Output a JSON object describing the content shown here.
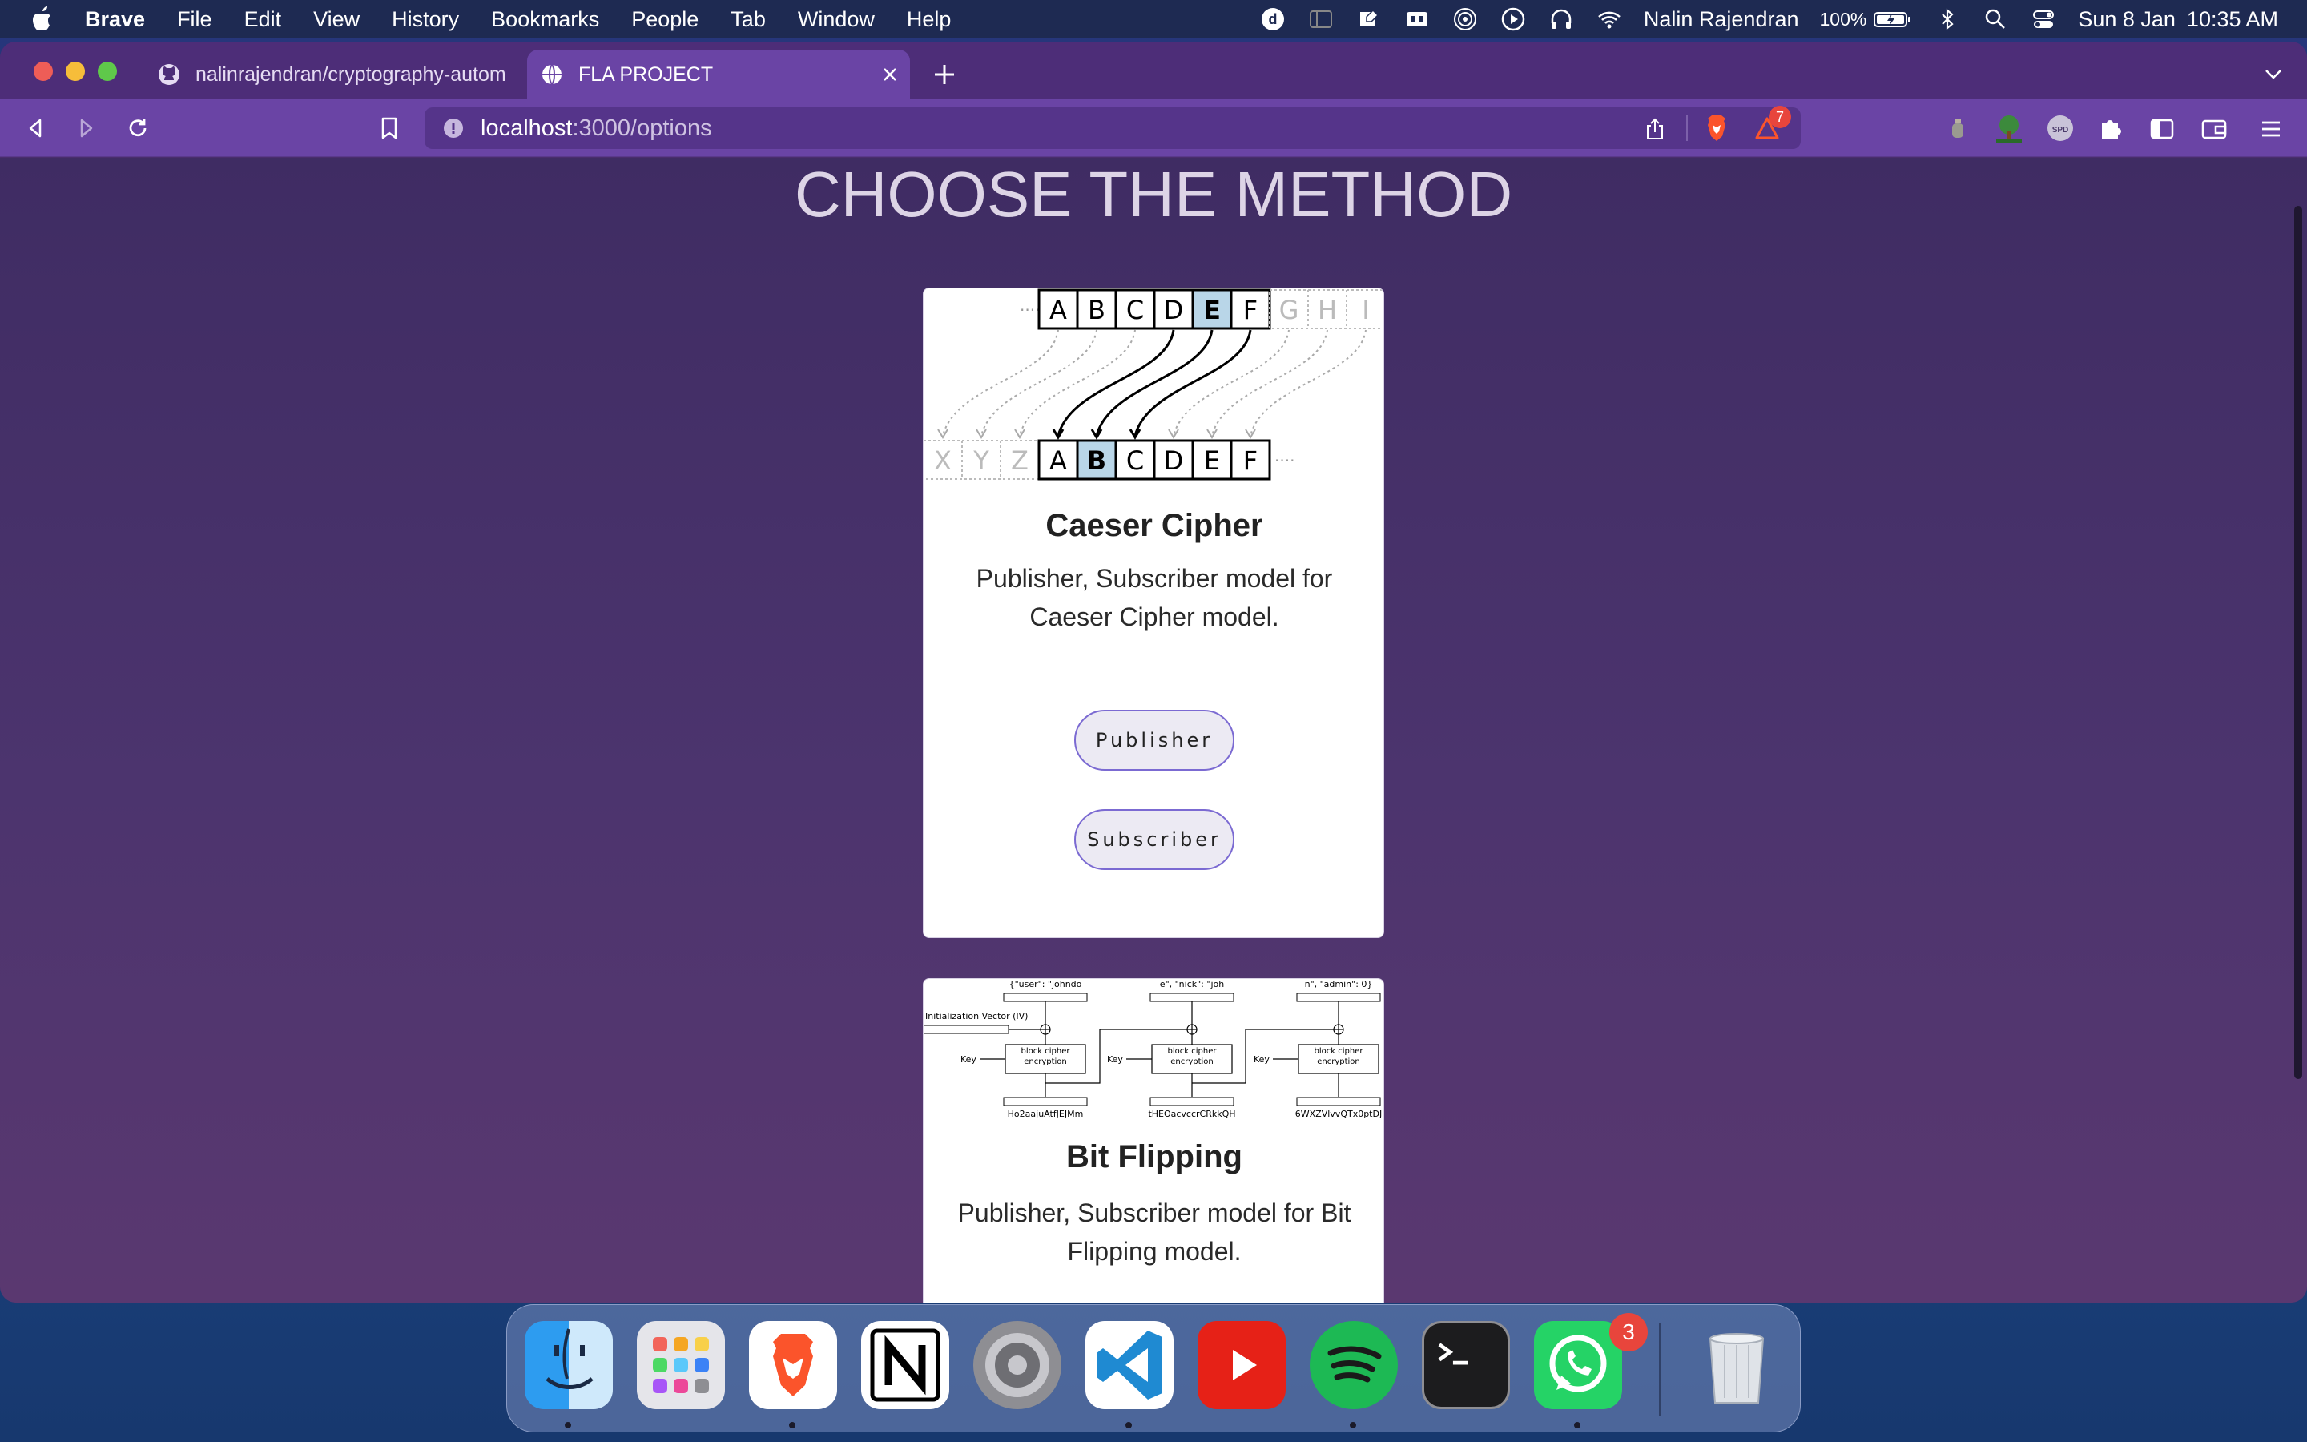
{
  "menubar": {
    "app_name": "Brave",
    "items": [
      "File",
      "Edit",
      "View",
      "History",
      "Bookmarks",
      "People",
      "Tab",
      "Window",
      "Help"
    ],
    "user_name": "Nalin Rajendran",
    "battery": "100%",
    "date": "Sun 8 Jan",
    "time": "10:35 AM"
  },
  "browser": {
    "tabs": [
      {
        "title": "nalinrajendran/cryptography-autom",
        "icon": "github-icon",
        "active": false
      },
      {
        "title": "FLA PROJECT",
        "icon": "globe-icon",
        "active": true
      }
    ],
    "url_host": "localhost",
    "url_path": ":3000/options",
    "shields_badge": "7"
  },
  "page": {
    "heading": "CHOOSE THE METHOD",
    "cards": [
      {
        "title": "Caeser Cipher",
        "description": "Publisher, Subscriber model for Caeser Cipher model.",
        "buttons": [
          "Publisher",
          "Subscriber"
        ],
        "illustration": {
          "top_row": [
            "A",
            "B",
            "C",
            "D",
            "E",
            "F"
          ],
          "top_faded": [
            "G",
            "H",
            "I"
          ],
          "bottom_faded": [
            "X",
            "Y",
            "Z"
          ],
          "bottom_row": [
            "A",
            "B",
            "C",
            "D",
            "E",
            "F"
          ],
          "highlight_top": "E",
          "highlight_bottom": "B"
        }
      },
      {
        "title": "Bit Flipping",
        "description": "Publisher, Subscriber model for Bit Flipping model.",
        "illustration": {
          "plaintext_blocks": [
            "{\"user\": \"johndo",
            "e\", \"nick\": \"joh",
            "n\", \"admin\": 0}"
          ],
          "iv_label": "Initialization Vector (IV)",
          "key_label": "Key",
          "block_label": "block cipher encryption",
          "ciphertext_blocks": [
            "Ho2aajuAtfJEJMm",
            "tHEOacvccrCRkkQH",
            "6WXZVlvvQTx0ptDJ"
          ]
        }
      }
    ]
  },
  "dock": {
    "apps": [
      "finder-icon",
      "launchpad-icon",
      "brave-icon",
      "notion-icon",
      "system-preferences-icon",
      "vscode-icon",
      "youtube-icon",
      "spotify-icon",
      "terminal-icon",
      "whatsapp-icon",
      "trash-icon"
    ],
    "whatsapp_badge": "3"
  },
  "colors": {
    "accent": "#6a44a5",
    "highlight": "#b9d6e8",
    "button_border": "#7b6ad2"
  }
}
